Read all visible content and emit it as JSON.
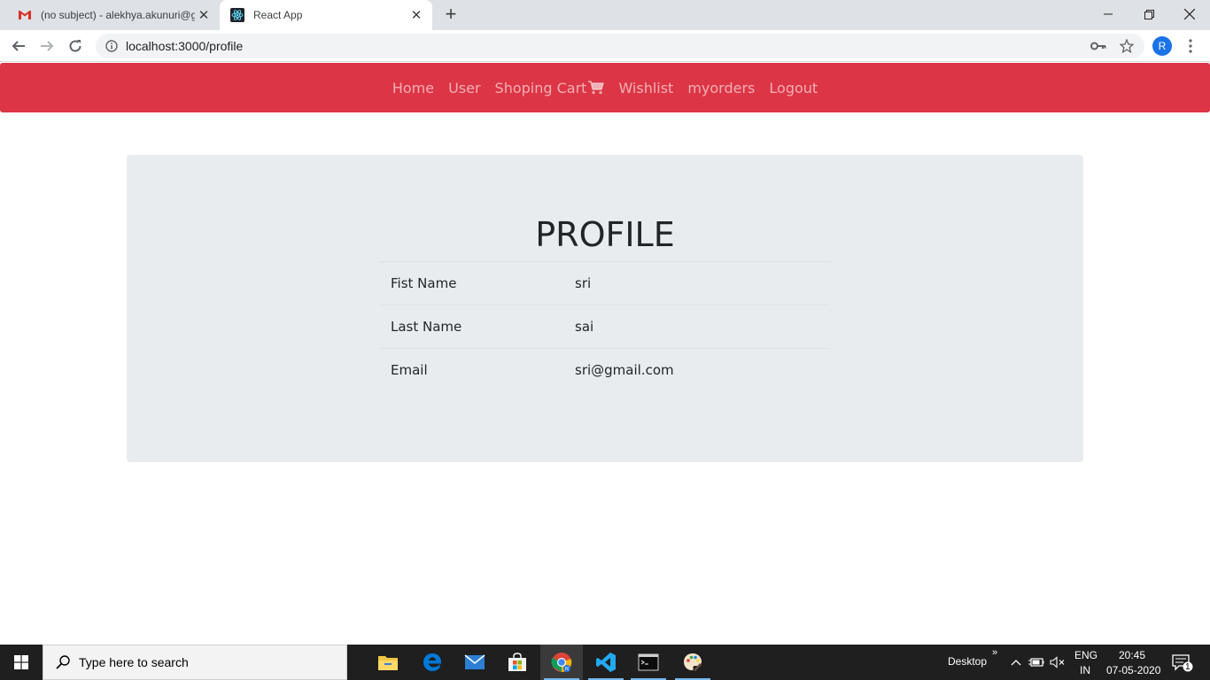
{
  "browser": {
    "tabs": [
      {
        "title": "(no subject) - alekhya.akunuri@g",
        "icon": "gmail-icon",
        "active": false
      },
      {
        "title": "React App",
        "icon": "react-icon",
        "active": true
      }
    ],
    "url": "localhost:3000/profile"
  },
  "navbar": {
    "color": "#dc3545",
    "links": {
      "home": "Home",
      "user": "User",
      "cart": "Shoping Cart",
      "wishlist": "Wishlist",
      "orders": "myorders",
      "logout": "Logout"
    }
  },
  "profile": {
    "heading": "PROFILE",
    "rows": [
      {
        "label": "Fist Name",
        "value": "sri"
      },
      {
        "label": "Last Name",
        "value": "sai"
      },
      {
        "label": "Email",
        "value": "sri@gmail.com"
      }
    ]
  },
  "taskbar": {
    "search_placeholder": "Type here to search",
    "toolbar_label": "Desktop",
    "language_line1": "ENG",
    "language_line2": "IN",
    "time": "20:45",
    "date": "07-05-2020",
    "notification_count": "1",
    "apps": [
      "file-explorer-icon",
      "edge-icon",
      "mail-icon",
      "store-icon",
      "chrome-icon",
      "vscode-icon",
      "terminal-icon",
      "paint-icon"
    ]
  },
  "avatar_letter": "R"
}
